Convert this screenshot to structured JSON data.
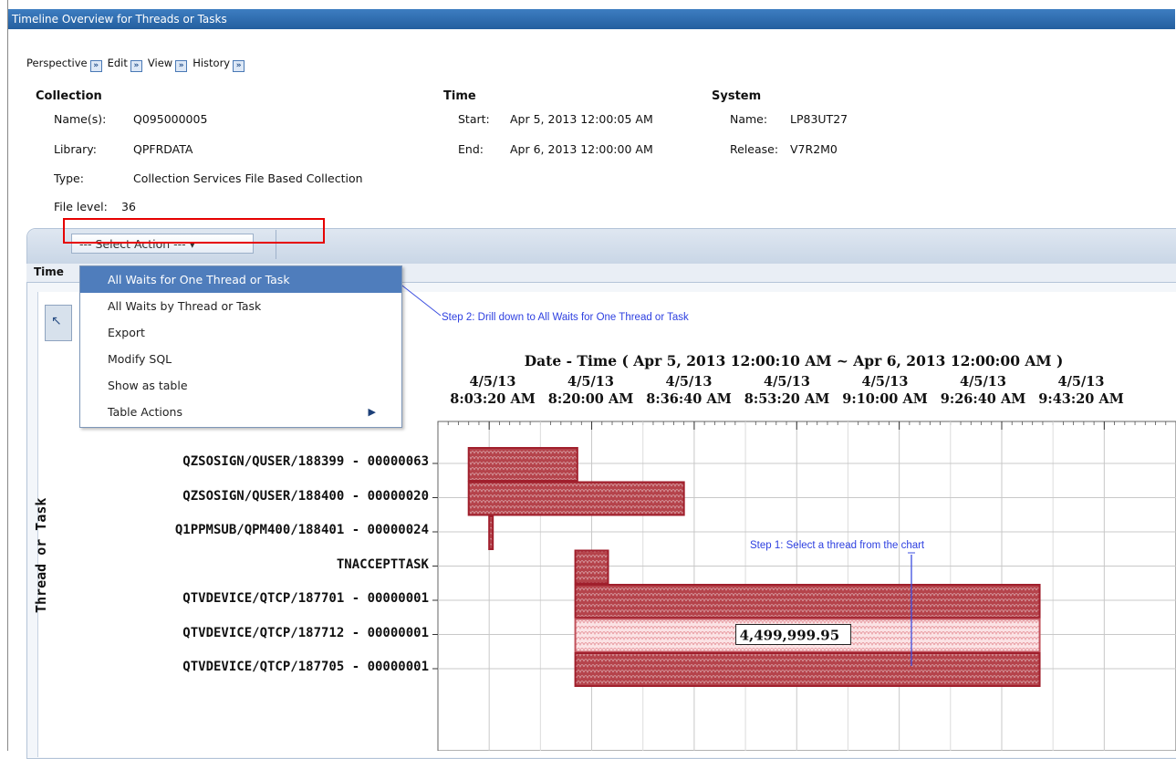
{
  "window": {
    "title": "Timeline Overview for Threads or Tasks"
  },
  "nav": {
    "perspective": "Perspective",
    "edit": "Edit",
    "view": "View",
    "history": "History"
  },
  "collection": {
    "heading": "Collection",
    "names_label": "Name(s):",
    "names_value": "Q095000005",
    "library_label": "Library:",
    "library_value": "QPFRDATA",
    "type_label": "Type:",
    "type_value": "Collection Services File Based Collection",
    "file_level_label": "File level:",
    "file_level_value": "36"
  },
  "time": {
    "heading": "Time",
    "start_label": "Start:",
    "start_value": "Apr 5, 2013 12:00:05 AM",
    "end_label": "End:",
    "end_value": "Apr 6, 2013 12:00:00 AM"
  },
  "system": {
    "heading": "System",
    "name_label": "Name:",
    "name_value": "LP83UT27",
    "release_label": "Release:",
    "release_value": "V7R2M0"
  },
  "toolbar": {
    "select_action": "--- Select Action --- ▾"
  },
  "tab": {
    "label": "Time"
  },
  "menu": {
    "items": [
      {
        "label": "All Waits for One Thread or Task",
        "highlighted": true
      },
      {
        "label": "All Waits by Thread or Task"
      },
      {
        "label": "Export"
      },
      {
        "label": "Modify SQL"
      },
      {
        "label": "Show as table"
      },
      {
        "label": "Table Actions",
        "submenu": true
      }
    ],
    "submenu_arrow": "▶"
  },
  "callouts": {
    "step2": "Step 2: Drill down to All Waits for One Thread or Task",
    "step1": "Step 1: Select a thread from the chart"
  },
  "chart_data": {
    "type": "bar",
    "orientation": "horizontal-timeline",
    "title": "Date - Time ( Apr 5, 2013 12:00:10 AM ~ Apr 6, 2013 12:00:00 AM )",
    "ylabel": "Thread or Task",
    "x_ticks": [
      "4/5/13\n8:03:20 AM",
      "4/5/13\n8:20:00 AM",
      "4/5/13\n8:36:40 AM",
      "4/5/13\n8:53:20 AM",
      "4/5/13\n9:10:00 AM",
      "4/5/13\n9:26:40 AM",
      "4/5/13\n9:43:20 AM"
    ],
    "x_axis_start": "4/5/13 7:55:00 AM",
    "x_axis_end": "4/5/13 9:55:00 AM",
    "categories": [
      "QZSOSIGN/QUSER/188399 - 00000063",
      "QZSOSIGN/QUSER/188400 - 00000020",
      "Q1PPMSUB/QPM400/188401 - 00000024",
      "TNACCEPTTASK",
      "QTVDEVICE/QTCP/187701 - 00000001",
      "QTVDEVICE/QTCP/187712 - 00000001",
      "QTVDEVICE/QTCP/187705 - 00000001"
    ],
    "bars": [
      {
        "start": "8:00:00 AM",
        "end": "8:17:40 AM"
      },
      {
        "start": "8:00:00 AM",
        "end": "8:35:00 AM"
      },
      {
        "start": "8:03:20 AM",
        "end": "8:03:50 AM"
      },
      {
        "start": "8:17:20 AM",
        "end": "8:22:40 AM"
      },
      {
        "start": "8:17:20 AM",
        "end": "9:32:50 AM"
      },
      {
        "start": "8:17:20 AM",
        "end": "9:32:50 AM",
        "selected": true,
        "value_label": "4,499,999.95"
      },
      {
        "start": "8:17:20 AM",
        "end": "9:32:50 AM"
      }
    ],
    "bar_color": "#b5434b",
    "selected_color": "#e89aa0",
    "grid": true
  }
}
